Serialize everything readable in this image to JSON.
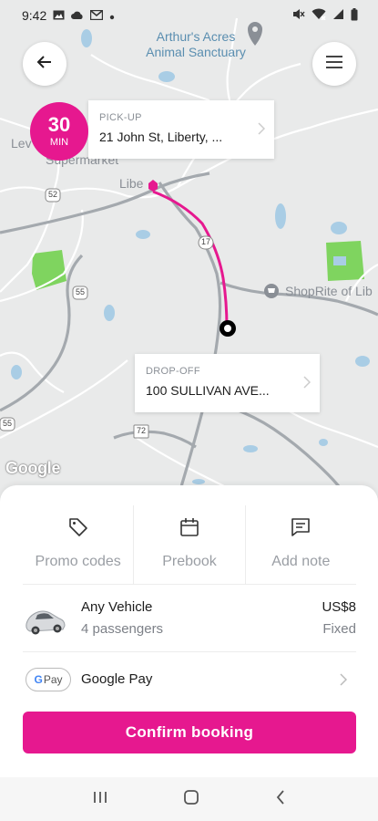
{
  "status_bar": {
    "time": "9:42",
    "left_icons": [
      "image-icon",
      "cloud-icon",
      "gmail-icon",
      "dot-icon"
    ],
    "right_icons": [
      "mute-icon",
      "wifi-icon",
      "signal-icon",
      "battery-icon"
    ]
  },
  "map": {
    "poi_arthurs_acres": "Arthur's Acres\nAnimal Sanctuary",
    "poi_shoprite": "ShopRite of Lib",
    "label_liberty": "Libe",
    "label_supermarket": "Supermarket",
    "label_lev": "Lev",
    "route_52": "52",
    "route_17": "17",
    "route_55": "55",
    "route_55b": "55",
    "route_72": "72",
    "google_attribution": "Google",
    "route_color": "#e6188f",
    "water_color": "#a9cde5",
    "park_color": "#7fd45f"
  },
  "trip": {
    "eta_value": "30",
    "eta_unit": "MIN",
    "pickup_caption": "PICK-UP",
    "pickup_address": "21 John St, Liberty, ...",
    "dropoff_caption": "DROP-OFF",
    "dropoff_address": "100 SULLIVAN AVE..."
  },
  "actions": [
    {
      "label": "Promo codes",
      "icon": "tag-icon"
    },
    {
      "label": "Prebook",
      "icon": "calendar-icon"
    },
    {
      "label": "Add note",
      "icon": "note-icon"
    }
  ],
  "vehicle": {
    "name": "Any Vehicle",
    "passengers": "4 passengers",
    "price": "US$8",
    "price_type": "Fixed"
  },
  "payment": {
    "badge_g": "G",
    "badge_text": "Pay",
    "method": "Google Pay"
  },
  "confirm_label": "Confirm booking",
  "brand_color": "#e6188f"
}
